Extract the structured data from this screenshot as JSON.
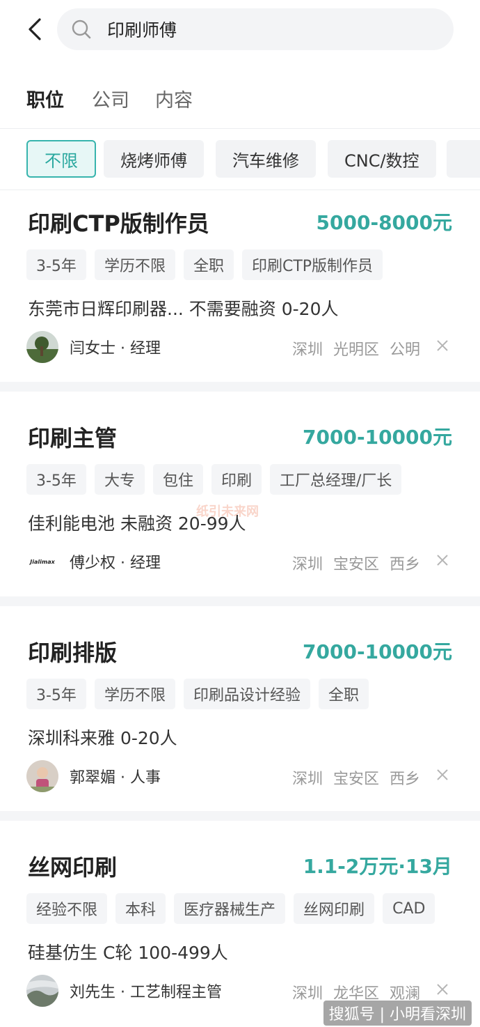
{
  "search": {
    "query": "印刷师傅"
  },
  "tabs": [
    {
      "label": "职位"
    },
    {
      "label": "公司"
    },
    {
      "label": "内容"
    }
  ],
  "filters": [
    {
      "label": "不限"
    },
    {
      "label": "烧烤师傅"
    },
    {
      "label": "汽车维修"
    },
    {
      "label": "CNC/数控"
    }
  ],
  "jobs": [
    {
      "title": "印刷CTP版制作员",
      "salary": "5000-8000元",
      "tags": [
        "3-5年",
        "学历不限",
        "全职",
        "印刷CTP版制作员"
      ],
      "company": "东莞市日辉印刷器... 不需要融资 0-20人",
      "recruiter": "闫女士 · 经理",
      "location": "深圳 光明区 公明"
    },
    {
      "title": "印刷主管",
      "salary": "7000-10000元",
      "tags": [
        "3-5年",
        "大专",
        "包住",
        "印刷",
        "工厂总经理/厂长"
      ],
      "company": "佳利能电池 未融资 20-99人",
      "recruiter": "傅少权 · 经理",
      "location": "深圳 宝安区 西乡",
      "logo_text": "Jialimax"
    },
    {
      "title": "印刷排版",
      "salary": "7000-10000元",
      "tags": [
        "3-5年",
        "学历不限",
        "印刷品设计经验",
        "全职"
      ],
      "company": "深圳科来雅 0-20人",
      "recruiter": "郭翠媚 · 人事",
      "location": "深圳 宝安区 西乡"
    },
    {
      "title": "丝网印刷",
      "salary": "1.1-2万元·13月",
      "tags": [
        "经验不限",
        "本科",
        "医疗器械生产",
        "丝网印刷",
        "CAD"
      ],
      "company": "硅基仿生 C轮 100-499人",
      "recruiter": "刘先生 · 工艺制程主管",
      "location": "深圳 龙华区 观澜"
    }
  ],
  "watermark": "纸引未来网",
  "footer": "搜狐号 | 小明看深圳",
  "colors": {
    "accent": "#35a89f",
    "selected_bg": "#e7f7f6"
  }
}
